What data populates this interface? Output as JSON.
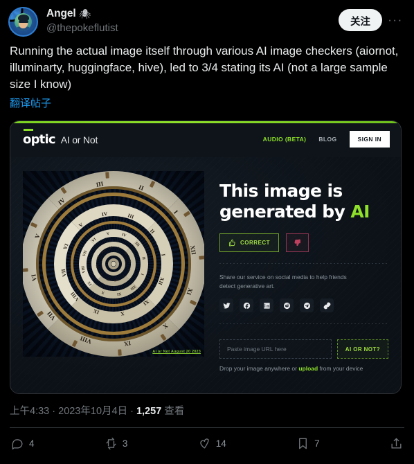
{
  "author": {
    "display_name": "Angel",
    "emoji": "🕷",
    "handle": "@thepokeflutist",
    "avatar_alt": "avatar"
  },
  "header": {
    "follow_label": "关注",
    "more_label": "···"
  },
  "post": {
    "text": "Running the actual image itself through various AI image checkers (aiornot, illuminarty, huggingface, hive), led to 3/4 stating its AI (not a large sample size I know)",
    "translate_label": "翻译帖子"
  },
  "media": {
    "nav": {
      "logo_word": "optic",
      "logo_sub": "AI or Not",
      "audio_label": "AUDIO (BETA)",
      "blog_label": "BLOG",
      "signin_label": "SIGN IN"
    },
    "image": {
      "watermark": "Ai or Not August 20 2023"
    },
    "result": {
      "title_prefix": "This image is generated by ",
      "title_highlight": "AI",
      "correct_label": "CORRECT",
      "share_prompt": "Share our service on social media to help friends detect generative art.",
      "share_icons": [
        "twitter-icon",
        "facebook-icon",
        "linkedin-icon",
        "reddit-icon",
        "telegram-icon",
        "link-icon"
      ],
      "url_placeholder": "Paste image URL here",
      "url_button_label": "AI OR NOT?",
      "drop_prefix": "Drop your image anywhere or ",
      "drop_link": "upload",
      "drop_suffix": " from your device"
    }
  },
  "meta": {
    "time": "上午4:33",
    "sep1": " · ",
    "date": "2023年10月4日",
    "sep2": " · ",
    "views_count": "1,257",
    "views_label": " 查看"
  },
  "actions": {
    "reply_count": "4",
    "retweet_count": "3",
    "like_count": "14",
    "bookmark_count": "7"
  },
  "colors": {
    "accent_green": "#8ee02a",
    "link_blue": "#1d9bf0",
    "text_primary": "#e7e9ea",
    "text_muted": "#71767b"
  }
}
